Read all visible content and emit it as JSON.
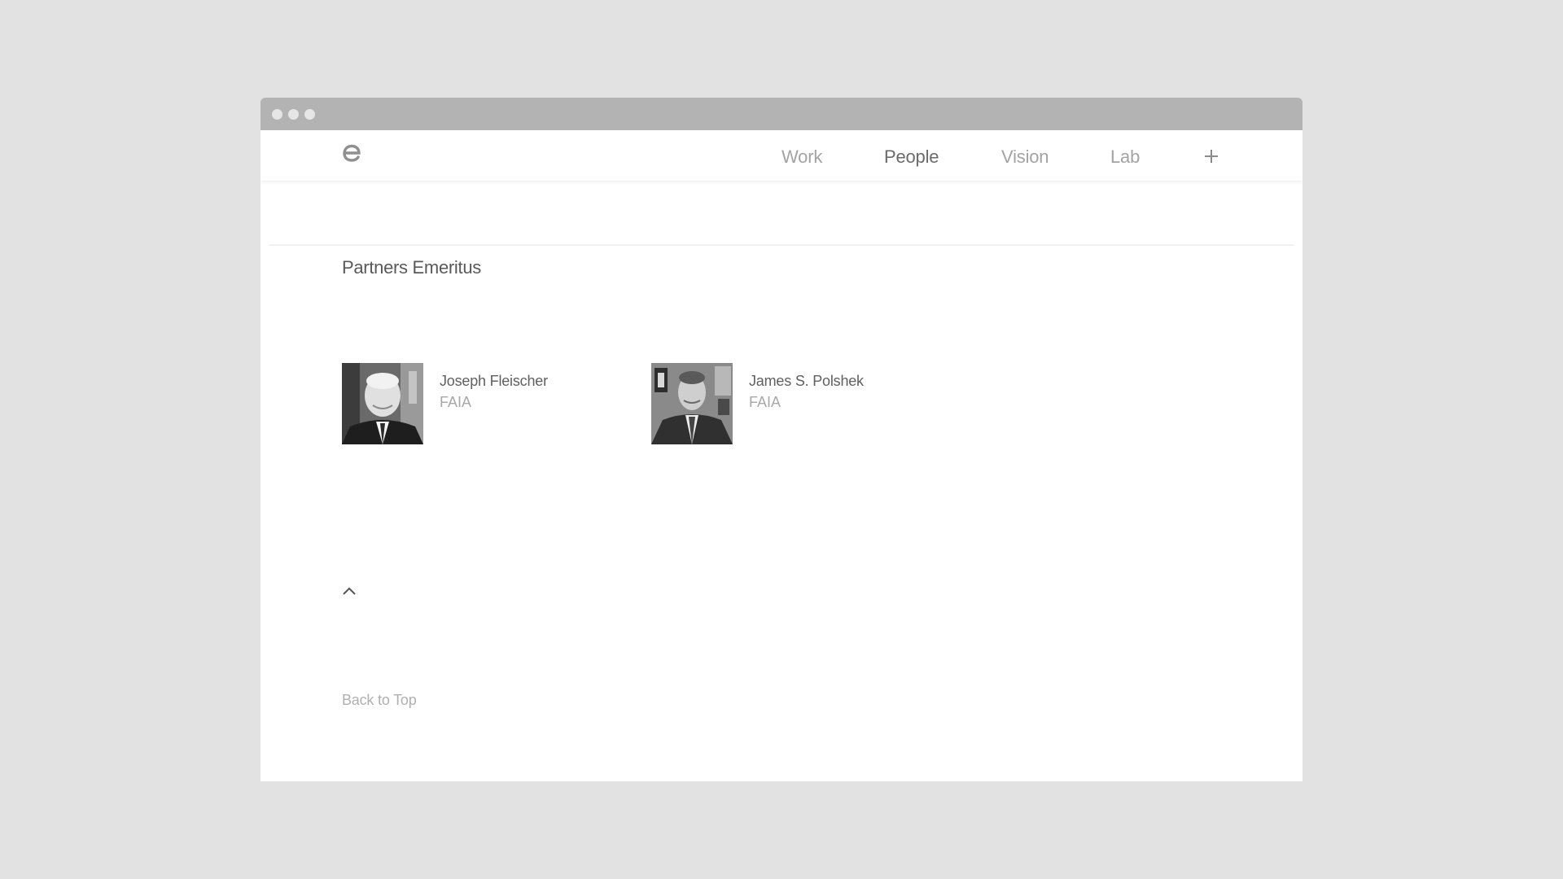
{
  "window": {
    "controls": [
      "window-dot",
      "window-dot",
      "window-dot"
    ]
  },
  "header": {
    "logo_icon": "e-logo-icon",
    "nav": [
      {
        "label": "Work",
        "active": false
      },
      {
        "label": "People",
        "active": true
      },
      {
        "label": "Vision",
        "active": false
      },
      {
        "label": "Lab",
        "active": false
      }
    ],
    "menu_icon": "plus-icon"
  },
  "section": {
    "title": "Partners Emeritus"
  },
  "people": [
    {
      "name": "Joseph Fleischer",
      "title": "FAIA",
      "photo_icon": "portrait-photo"
    },
    {
      "name": "James S. Polshek",
      "title": "FAIA",
      "photo_icon": "portrait-photo"
    }
  ],
  "footer": {
    "scroll_icon": "chevron-up-icon",
    "back_to_top": "Back to Top"
  },
  "colors": {
    "page_background": "#e2e2e2",
    "titlebar": "#b3b3b3",
    "nav_inactive": "#a3a3a3",
    "nav_active": "#6b6b6b"
  }
}
